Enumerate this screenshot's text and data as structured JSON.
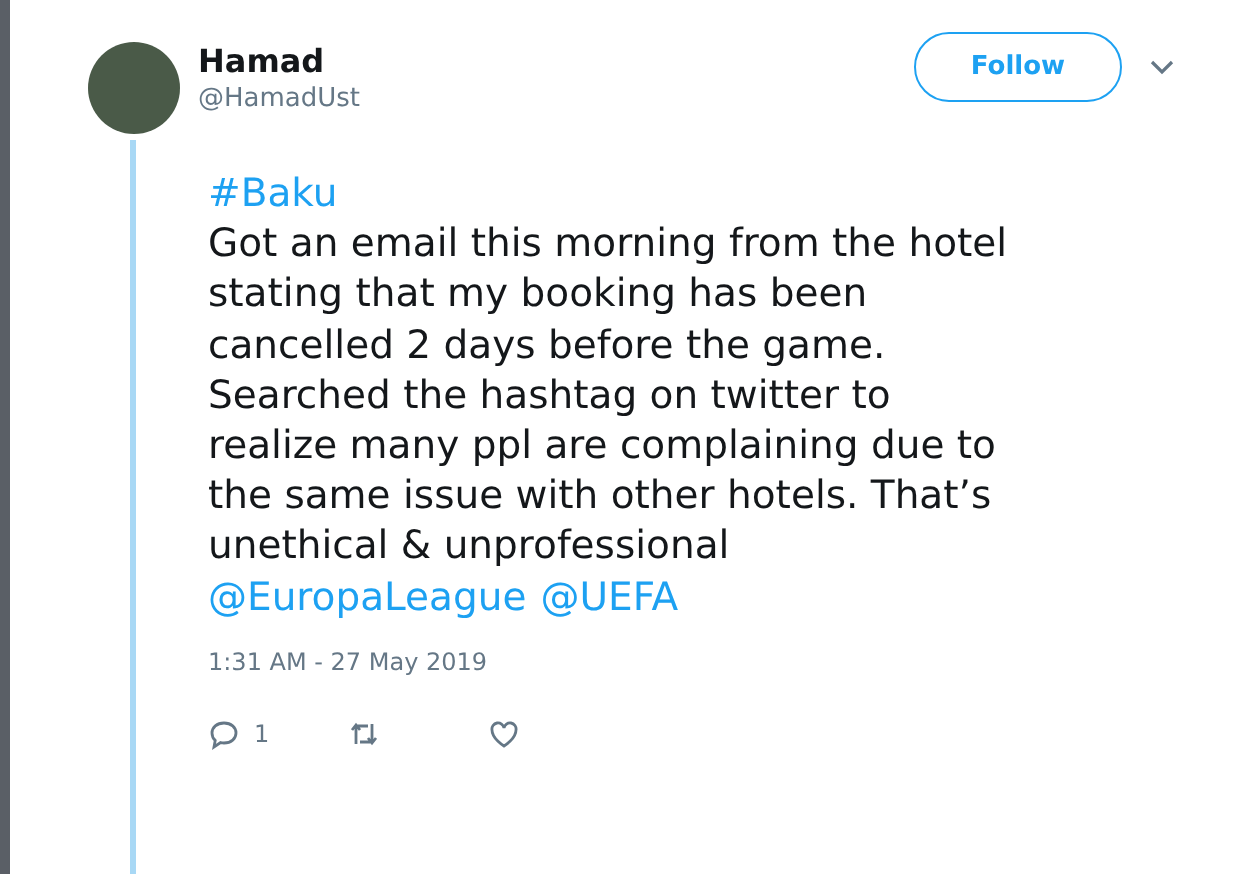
{
  "author": {
    "name": "Hamad",
    "handle": "@HamadUst"
  },
  "follow_button": {
    "label": "Follow"
  },
  "tweet": {
    "hashtag": "#Baku",
    "text": "Got an email this morning from the hotel\nstating that my booking has been\ncancelled 2 days before the game.\nSearched the hashtag on twitter to\nrealize many ppl are complaining due to\nthe same issue with other hotels. That’s\nunethical & unprofessional",
    "mentions": [
      "@EuropaLeague",
      "@UEFA"
    ],
    "timestamp": "1:31 AM - 27 May 2019"
  },
  "actions": [
    {
      "kind": "reply",
      "count": "1"
    },
    {
      "kind": "retweet"
    },
    {
      "kind": "like"
    }
  ]
}
